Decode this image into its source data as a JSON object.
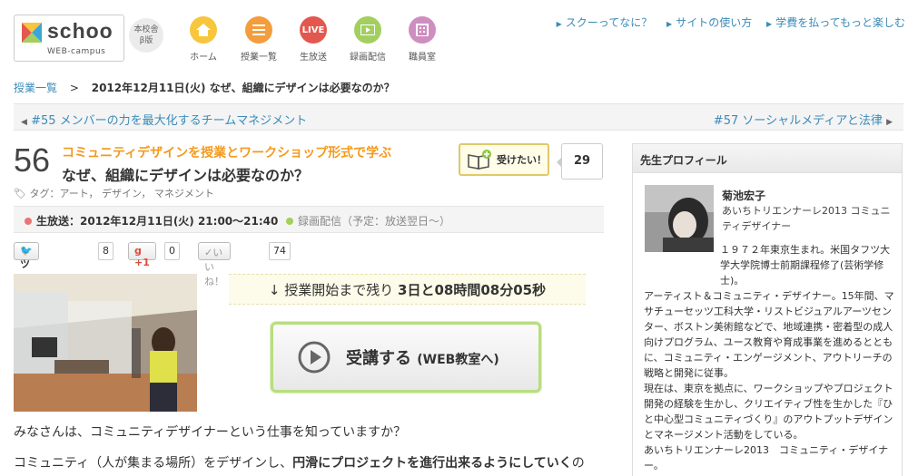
{
  "header": {
    "logo_text": "schoo",
    "logo_sub": "WEB-campus",
    "beta_line1": "本校舎",
    "beta_line2": "β版",
    "nav": [
      {
        "label": "ホーム",
        "icon": "home-icon",
        "color": "#f7c63c"
      },
      {
        "label": "授業一覧",
        "icon": "list-icon",
        "color": "#f39d3c"
      },
      {
        "label": "生放送",
        "icon": "live-icon",
        "color": "#e2584e",
        "badge": "LIVE"
      },
      {
        "label": "録画配信",
        "icon": "video-icon",
        "color": "#a2cf5e"
      },
      {
        "label": "職員室",
        "icon": "building-icon",
        "color": "#cf8ec0"
      }
    ],
    "links": [
      "スクーってなに？",
      "サイトの使い方",
      "学費を払ってもっと楽しむ"
    ]
  },
  "breadcrumb": {
    "parent": "授業一覧",
    "sep": ">",
    "current": "2012年12月11日(火) なぜ、組織にデザインは必要なのか？"
  },
  "pager": {
    "prev": "#55 メンバーの力を最大化するチームマネジメント",
    "next": "#57 ソーシャルメディアと法律"
  },
  "lesson": {
    "number": "56",
    "subtitle": "コミュニティデザインを授業とワークショップ形式で学ぶ",
    "title": "なぜ、組織にデザインは必要なのか？",
    "tags": "タグ：アート，  デザイン，  マネジメント",
    "want_label": "受けたい！",
    "want_count": "29"
  },
  "broadcast": {
    "live_label": "生放送：",
    "live_time": "2012年12月11日(火) 21:00〜21:40",
    "rec_label": "録画配信（予定：放送翌日〜）"
  },
  "social": {
    "tweet_label": "ツイートする",
    "tweet_count": "8",
    "gplus_label": "+1",
    "gplus_count": "0",
    "like_label": "いいね！",
    "like_count": "74"
  },
  "countdown": {
    "prefix": "↓ 授業開始まで残り",
    "value": "3日と08時間08分05秒"
  },
  "cta": {
    "label": "受講する",
    "sub": "(WEB教室へ)"
  },
  "body": {
    "p1": "みなさんは、コミュニティデザイナーという仕事を知っていますか？",
    "p2a": "コミュニティ（人が集まる場所）をデザインし、",
    "p2b": "円滑にプロジェクトを進行出来るようにしていく",
    "p2c": "の"
  },
  "profile": {
    "heading": "先生プロフィール",
    "name": "菊池宏子",
    "role": "あいちトリエンナーレ2013 コミュニティデザイナー",
    "bio1": "１９７２年東京生まれ。米国タフツ大学大学院博士前期課程修了(芸術学修士)。",
    "bio2": "アーティスト＆コミュニティ・デザイナー。15年間、マサチューセッツ工科大学・リストビジュアルアーツセンター、ボストン美術館などで、地域連携・密着型の成人向けプログラム、ユース教育や育成事業を進めるとともに、コミュニティ・エンゲージメント、アウトリーチの戦略と開発に従事。",
    "bio3": "現在は、東京を拠点に、ワークショップやプロジェクト開発の経験を生かし、クリエイティブ性を生かした『ひと中心型コミュニティづくり』のアウトプットデザインとマネージメント活動をしている。",
    "bio4": "あいちトリエンナーレ2013　コミュニティ・デザイナー。"
  },
  "colors": {
    "link": "#3a8bb8",
    "accent_orange": "#f39a1e",
    "live_red": "#e2584e",
    "rec_green": "#a2cf5e",
    "cta_border": "#b8de7f"
  }
}
